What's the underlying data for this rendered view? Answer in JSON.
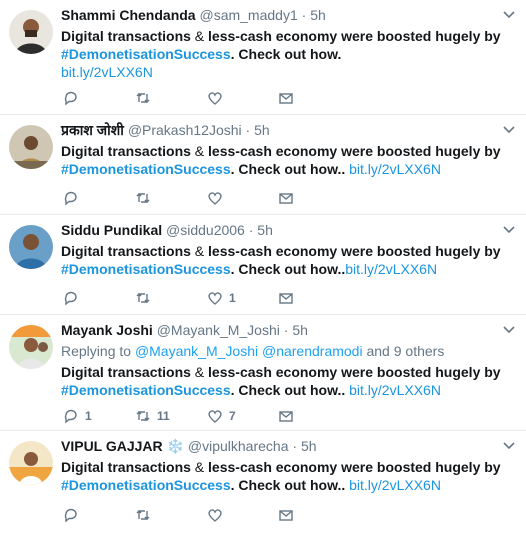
{
  "tweets": [
    {
      "name": "Shammi Chendanda",
      "handle": "@sam_maddy1",
      "time": "5h",
      "verified_badge": "",
      "replying": null,
      "text_a": "Digital transactions",
      "text_b": " & ",
      "text_c": "less-cash economy were boosted hugely by ",
      "hashtag": "#DemonetisationSuccess",
      "text_d": ". Check out how.",
      "link_sep": " ",
      "link": "bit.ly/2vLXX6N",
      "reply_count": "",
      "retweet_count": "",
      "like_count": ""
    },
    {
      "name": "प्रकाश जोशी",
      "handle": "@Prakash12Joshi",
      "time": "5h",
      "verified_badge": "",
      "replying": null,
      "text_a": "Digital transactions",
      "text_b": " & ",
      "text_c": "less-cash economy were boosted hugely by ",
      "hashtag": "#DemonetisationSuccess",
      "text_d": ". Check out how..",
      "link_sep": " ",
      "link": "bit.ly/2vLXX6N",
      "reply_count": "",
      "retweet_count": "",
      "like_count": ""
    },
    {
      "name": "Siddu Pundikal",
      "handle": "@siddu2006",
      "time": "5h",
      "verified_badge": "",
      "replying": null,
      "text_a": "Digital transactions",
      "text_b": " & ",
      "text_c": "less-cash economy were boosted hugely by ",
      "hashtag": "#DemonetisationSuccess",
      "text_d": ". Check out how..",
      "link_sep": "",
      "link": "bit.ly/2vLXX6N",
      "reply_count": "",
      "retweet_count": "",
      "like_count": "1"
    },
    {
      "name": "Mayank Joshi",
      "handle": "@Mayank_M_Joshi",
      "time": "5h",
      "verified_badge": "",
      "replying": {
        "prefix": "Replying to",
        "user1": "@Mayank_M_Joshi",
        "user2": "@narendramodi",
        "suffix": "and 9 others"
      },
      "text_a": "Digital transactions",
      "text_b": " & ",
      "text_c": "less-cash economy were boosted hugely by ",
      "hashtag": "#DemonetisationSuccess",
      "text_d": ". Check out how..",
      "link_sep": " ",
      "link": "bit.ly/2vLXX6N",
      "reply_count": "1",
      "retweet_count": "11",
      "like_count": "7"
    },
    {
      "name": "VIPUL GAJJAR",
      "handle": "@vipulkharecha",
      "time": "5h",
      "verified_badge": "❄️",
      "replying": null,
      "text_a": "Digital transactions",
      "text_b": " & ",
      "text_c": "less-cash economy were boosted hugely by ",
      "hashtag": "#DemonetisationSuccess",
      "text_d": ". Check out how..",
      "link_sep": " ",
      "link": "bit.ly/2vLXX6N",
      "reply_count": "",
      "retweet_count": "",
      "like_count": ""
    }
  ],
  "dot": "·",
  "icons": {
    "reply": "reply-icon",
    "retweet": "retweet-icon",
    "like": "heart-icon",
    "dm": "envelope-icon",
    "caret": "chevron-down-icon"
  },
  "colors": {
    "link": "#1b95e0",
    "muted": "#657786",
    "text": "#14171a",
    "divider": "#e6ecf0"
  }
}
